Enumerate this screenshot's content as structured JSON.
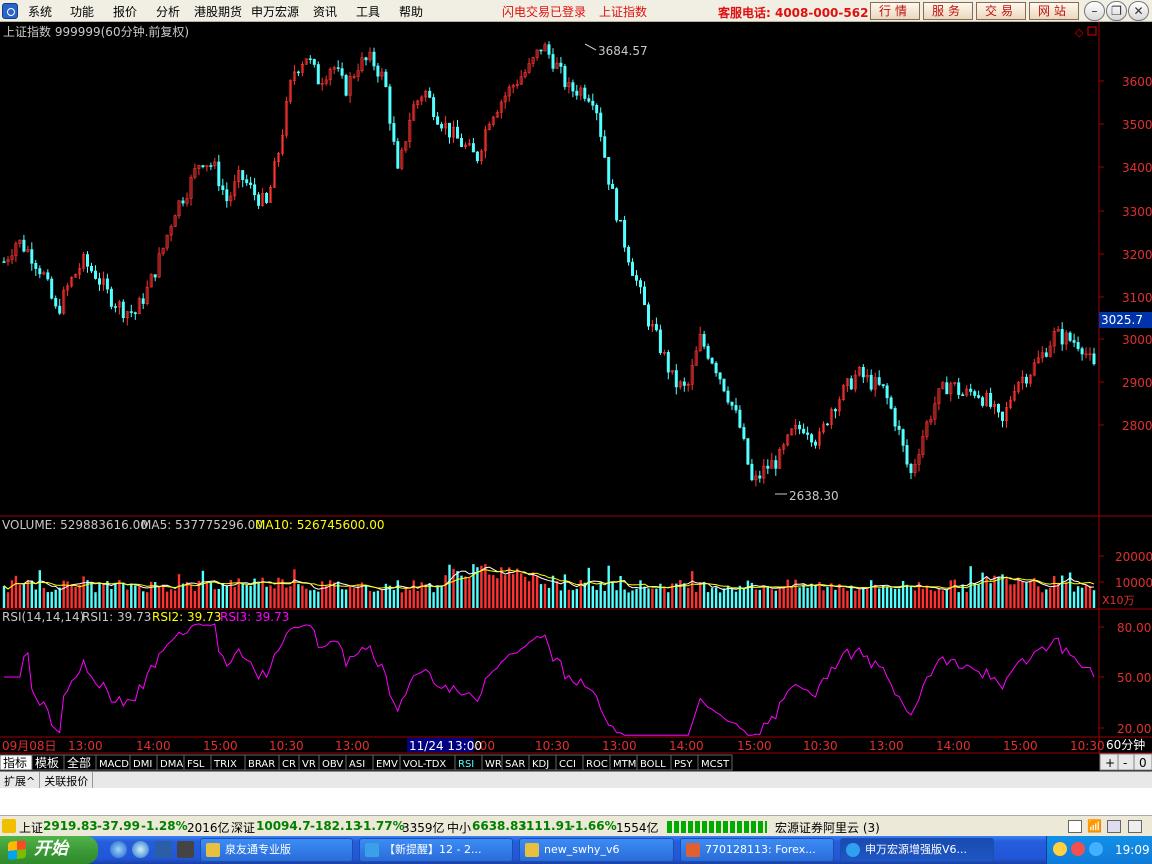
{
  "menu": {
    "items": [
      "系统",
      "功能",
      "报价",
      "分析",
      "港股期货",
      "申万宏源",
      "资讯",
      "工具",
      "帮助"
    ],
    "notice1": "闪电交易已登录",
    "notice2": "上证指数",
    "hotline": "客服电话: 4008-000-562",
    "buttons": [
      "行情",
      "服务",
      "交易",
      "网站"
    ]
  },
  "chart": {
    "title": "上证指数 999999(60分钟.前复权)",
    "high_label": "3684.57",
    "low_label": "2638.30",
    "current_price": "3025.7",
    "y_ticks": [
      "3600",
      "3500",
      "3400",
      "3300",
      "3200",
      "3100",
      "3000",
      "2900",
      "2800"
    ],
    "volume_header": {
      "label": "VOLUME: 529883616.00",
      "ma5": "MA5: 537775296.00",
      "ma10": "MA10: 526745600.00"
    },
    "volume_ticks": [
      "20000",
      "10000"
    ],
    "volume_unit": "X10万",
    "rsi_header": {
      "label": "RSI(14,14,14)",
      "rsi1": "RSI1: 39.73",
      "rsi2": "RSI2: 39.73",
      "rsi3": "RSI3: 39.73"
    },
    "rsi_ticks": [
      "80.00",
      "50.00",
      "20.00"
    ],
    "x_labels": [
      "09月08日",
      "13:00",
      "14:00",
      "15:00",
      "10:30",
      "13:00",
      "14:00",
      "15:00",
      "10:30",
      "13:00",
      "14:00",
      "15:00",
      "10:30",
      "13:00",
      "14:00",
      "15:00",
      "10:30"
    ],
    "cursor_label": "11/24 13:00",
    "period": "60分钟"
  },
  "chart_data": {
    "type": "candlestick",
    "title": "上证指数 999999(60分钟.前复权)",
    "price_path": [
      3180,
      3230,
      3200,
      3150,
      3060,
      3130,
      3180,
      3150,
      3100,
      3070,
      3060,
      3120,
      3200,
      3300,
      3350,
      3420,
      3400,
      3320,
      3380,
      3340,
      3310,
      3450,
      3620,
      3660,
      3600,
      3640,
      3580,
      3640,
      3650,
      3600,
      3380,
      3530,
      3580,
      3520,
      3480,
      3450,
      3420,
      3520,
      3560,
      3600,
      3630,
      3684,
      3640,
      3580,
      3580,
      3560,
      3380,
      3250,
      3150,
      3050,
      2980,
      2900,
      2880,
      3000,
      2950,
      2880,
      2800,
      2660,
      2700,
      2720,
      2780,
      2800,
      2760,
      2840,
      2880,
      2920,
      2900,
      2880,
      2800,
      2680,
      2780,
      2860,
      2900,
      2870,
      2880,
      2850,
      2800,
      2900,
      2920,
      2960,
      3010,
      3000,
      2990,
      2930
    ],
    "y_axis_range": [
      2638.3,
      3684.57
    ],
    "rsi_axis": [
      20,
      50,
      80
    ]
  },
  "tabs": [
    "指标",
    "模板",
    "全部",
    "MACD",
    "DMI",
    "DMA",
    "FSL",
    "TRIX",
    "BRAR",
    "CR",
    "VR",
    "OBV",
    "ASI",
    "EMV",
    "VOL-TDX",
    "RSI",
    "WR",
    "SAR",
    "KDJ",
    "CCI",
    "ROC",
    "MTM",
    "BOLL",
    "PSY",
    "MCST"
  ],
  "tabs_right": [
    "+",
    "-",
    "0"
  ],
  "subtabs": [
    "扩展^",
    "关联报价"
  ],
  "status": {
    "sh_label": "上证",
    "sh_value": "2919.83",
    "sh_chg": "-37.99",
    "sh_pct": "-1.28%",
    "sh_amt": "2016亿",
    "sz_label": "深证",
    "sz_value": "10094.7",
    "sz_chg": "-182.13",
    "sz_pct": "-1.77%",
    "sz_amt": "3359亿",
    "zx_label": "中小",
    "zx_value": "6638.83",
    "zx_chg": "-111.91",
    "zx_pct": "-1.66%",
    "zx_amt": "1554亿",
    "server": "宏源证券阿里云 (3)"
  },
  "taskbar": {
    "start": "开始",
    "tasks": [
      "泉友通专业版",
      "【新提醒】12 - 2...",
      "new_swhy_v6",
      "770128113: Forex...",
      "申万宏源增强版V6..."
    ],
    "clock": "19:09"
  },
  "colors": {
    "up": "#ff3232",
    "down": "#54ffff",
    "rsi": "#ff00ff",
    "ma5": "#ffffff",
    "ma10": "#ffff00",
    "axis": "#a00000"
  }
}
